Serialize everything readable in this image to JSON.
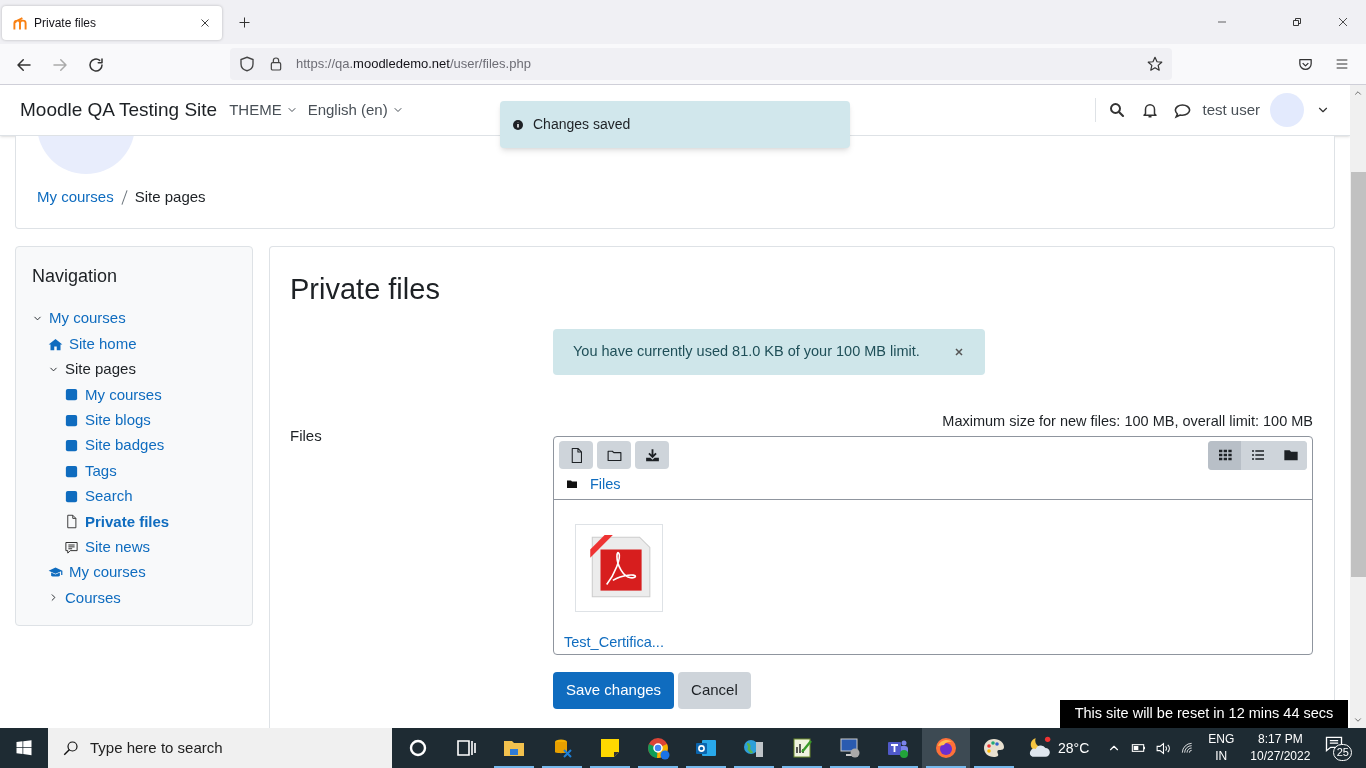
{
  "browser": {
    "tab_title": "Private files",
    "url_prefix": "https://qa.",
    "url_domain": "moodledemo.net",
    "url_path": "/user/files.php"
  },
  "navbar": {
    "site_name": "Moodle QA Testing Site",
    "menus": [
      "THEME",
      "English (en)"
    ],
    "user_name": "test user"
  },
  "toast": {
    "text": "Changes saved"
  },
  "breadcrumb": [
    {
      "label": "My courses",
      "link": true
    },
    {
      "label": "Site pages",
      "link": false
    }
  ],
  "navigation": {
    "title": "Navigation",
    "items": [
      {
        "label": "My courses",
        "kind": "expander",
        "link": true,
        "selected": false,
        "expanded": true,
        "children": [
          {
            "label": "Site home",
            "kind": "home",
            "link": true,
            "selected": false
          },
          {
            "label": "Site pages",
            "kind": "expander",
            "link": false,
            "selected": false,
            "expanded": true,
            "children": [
              {
                "label": "My courses",
                "kind": "square",
                "link": true,
                "selected": false
              },
              {
                "label": "Site blogs",
                "kind": "square",
                "link": true,
                "selected": false
              },
              {
                "label": "Site badges",
                "kind": "square",
                "link": true,
                "selected": false
              },
              {
                "label": "Tags",
                "kind": "square",
                "link": true,
                "selected": false
              },
              {
                "label": "Search",
                "kind": "square",
                "link": true,
                "selected": false
              },
              {
                "label": "Private files",
                "kind": "page",
                "link": true,
                "selected": true
              },
              {
                "label": "Site news",
                "kind": "news",
                "link": true,
                "selected": false
              }
            ]
          },
          {
            "label": "My courses",
            "kind": "cap",
            "link": true,
            "selected": false
          },
          {
            "label": "Courses",
            "kind": "expander",
            "link": true,
            "selected": false,
            "expanded": false
          }
        ]
      }
    ]
  },
  "main": {
    "heading": "Private files",
    "quota_alert": "You have currently used 81.0 KB of your 100 MB limit.",
    "files_label": "Files",
    "max_size": "Maximum size for new files: 100 MB, overall limit: 100 MB",
    "path": "Files",
    "views": [
      {
        "kind": "icons",
        "selected": true
      },
      {
        "kind": "list",
        "selected": false
      },
      {
        "kind": "tree",
        "selected": false
      }
    ],
    "files": [
      {
        "name": "Test_Certifica..."
      }
    ],
    "buttons": [
      {
        "label": "Save changes",
        "kind": "primary"
      },
      {
        "label": "Cancel",
        "kind": "secondary"
      }
    ]
  },
  "reset_banner": "This site will be reset in 12 mins 44 secs",
  "taskbar": {
    "search_placeholder": "Type here to search",
    "apps": [
      {
        "kind": "cortana",
        "running": false,
        "selected": false
      },
      {
        "kind": "taskview",
        "running": false,
        "selected": false
      },
      {
        "kind": "explorer",
        "running": true,
        "selected": false
      },
      {
        "kind": "xampp",
        "running": true,
        "selected": false
      },
      {
        "kind": "sticky",
        "running": true,
        "selected": false
      },
      {
        "kind": "chrome",
        "running": true,
        "selected": false
      },
      {
        "kind": "outlook",
        "running": true,
        "selected": false
      },
      {
        "kind": "globe",
        "running": true,
        "selected": false
      },
      {
        "kind": "chart",
        "running": true,
        "selected": false
      },
      {
        "kind": "remote",
        "running": true,
        "selected": false
      },
      {
        "kind": "teams",
        "running": true,
        "selected": false
      },
      {
        "kind": "firefox",
        "running": true,
        "selected": true
      },
      {
        "kind": "paint",
        "running": true,
        "selected": false
      }
    ],
    "temperature": "28°C",
    "language": [
      "ENG",
      "IN"
    ],
    "time": "8:17 PM",
    "date": "10/27/2022",
    "notifications": "25"
  }
}
